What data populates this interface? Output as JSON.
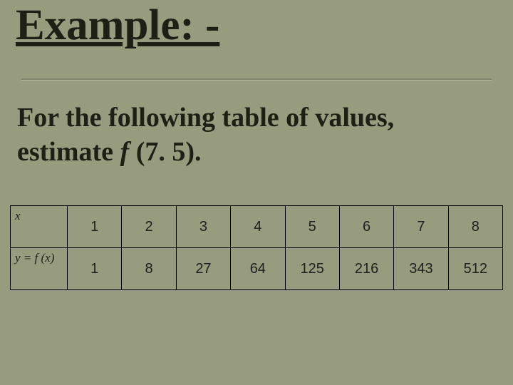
{
  "title": "Example: -",
  "prompt_a": "For the following table of values, estimate ",
  "prompt_f": "f",
  "prompt_b": " (7. 5).",
  "chart_data": {
    "type": "table",
    "row_headers": [
      "x",
      "y = f (x)"
    ],
    "columns": [
      "1",
      "2",
      "3",
      "4",
      "5",
      "6",
      "7",
      "8"
    ],
    "rows": [
      [
        "1",
        "2",
        "3",
        "4",
        "5",
        "6",
        "7",
        "8"
      ],
      [
        "1",
        "8",
        "27",
        "64",
        "125",
        "216",
        "343",
        "512"
      ]
    ]
  }
}
